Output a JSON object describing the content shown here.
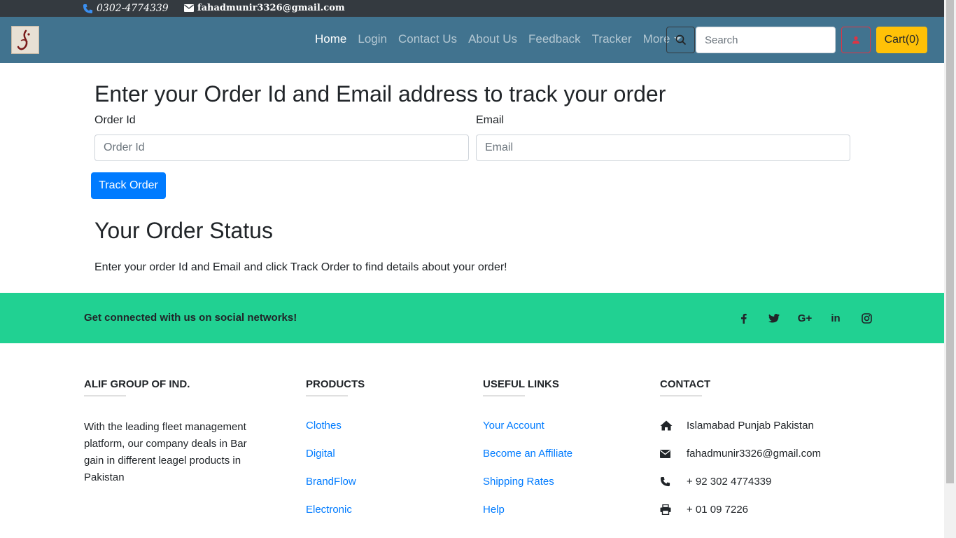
{
  "topbar": {
    "phone": "0302-4774339",
    "email": "fahadmunir3326@gmail.com"
  },
  "nav": {
    "items": [
      "Home",
      "Login",
      "Contact Us",
      "About Us",
      "Feedback",
      "Tracker",
      "More"
    ],
    "search_placeholder": "Search",
    "cart_label": "Cart(0)"
  },
  "main": {
    "heading": "Enter your Order Id and Email address to track your order",
    "order_id_label": "Order Id",
    "order_id_placeholder": "Order Id",
    "email_label": "Email",
    "email_placeholder": "Email",
    "track_button": "Track Order",
    "status_heading": "Your Order Status",
    "status_text": "Enter your order Id and Email and click Track Order to find details about your order!"
  },
  "social": {
    "text": "Get connected with us on social networks!",
    "icons": [
      "facebook-icon",
      "twitter-icon",
      "google-plus-icon",
      "linkedin-icon",
      "instagram-icon"
    ]
  },
  "footer": {
    "company": {
      "title": "ALIF GROUP OF IND.",
      "about": "With the leading fleet management platform, our company deals in Bar gain in different leagel products in Pakistan"
    },
    "products": {
      "title": "PRODUCTS",
      "links": [
        "Clothes",
        "Digital",
        "BrandFlow",
        "Electronic"
      ]
    },
    "useful": {
      "title": "USEFUL LINKS",
      "links": [
        "Your Account",
        "Become an Affiliate",
        "Shipping Rates",
        "Help"
      ]
    },
    "contact": {
      "title": "CONTACT",
      "address": "Islamabad Punjab Pakistan",
      "email": "fahadmunir3326@gmail.com",
      "phone": "+ 92 302 4774339",
      "fax": "+ 01 09 7226"
    }
  },
  "colors": {
    "topbar": "#343a40",
    "navbar": "#41738f",
    "social": "#21d192",
    "primary": "#007bff",
    "cart": "#ffc107"
  }
}
